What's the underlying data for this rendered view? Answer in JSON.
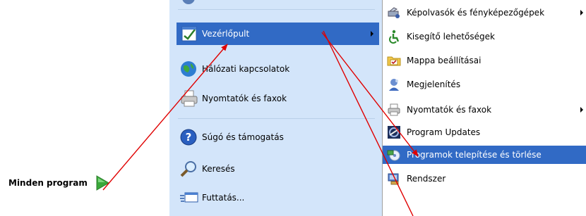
{
  "start_menu": {
    "all_programs_label": "Minden program",
    "items": [
      {
        "label": "Vezérlőpult",
        "icon": "control-panel-icon",
        "has_submenu": true
      },
      {
        "label": "Hálózati kapcsolatok",
        "icon": "network-connections-icon"
      },
      {
        "label": "Nyomtatók és faxok",
        "icon": "printers-icon"
      },
      {
        "label": "Súgó és támogatás",
        "icon": "help-icon"
      },
      {
        "label": "Keresés",
        "icon": "search-icon"
      },
      {
        "label": "Futtatás...",
        "icon": "run-icon"
      }
    ]
  },
  "control_panel_submenu": {
    "items": [
      {
        "label": "Képolvasók és fényképezőgépek",
        "icon": "scanner-camera-icon",
        "has_submenu": true
      },
      {
        "label": "Kisegítő lehetőségek",
        "icon": "accessibility-icon"
      },
      {
        "label": "Mappa beállításai",
        "icon": "folder-options-icon"
      },
      {
        "label": "Megjelenítés",
        "icon": "display-icon"
      },
      {
        "label": "Nyomtatók és faxok",
        "icon": "printers-icon",
        "has_submenu": true
      },
      {
        "label": "Program Updates",
        "icon": "program-updates-icon"
      },
      {
        "label": "Programok telepítése és törlése",
        "icon": "add-remove-programs-icon",
        "selected": true
      },
      {
        "label": "Rendszer",
        "icon": "system-icon"
      }
    ]
  },
  "colors": {
    "menu_pane_bg": "#d3e5fa",
    "selection_bg": "#316ac5",
    "annotation_arrow": "#e00000",
    "all_programs_arrow": "#3aa83a"
  }
}
